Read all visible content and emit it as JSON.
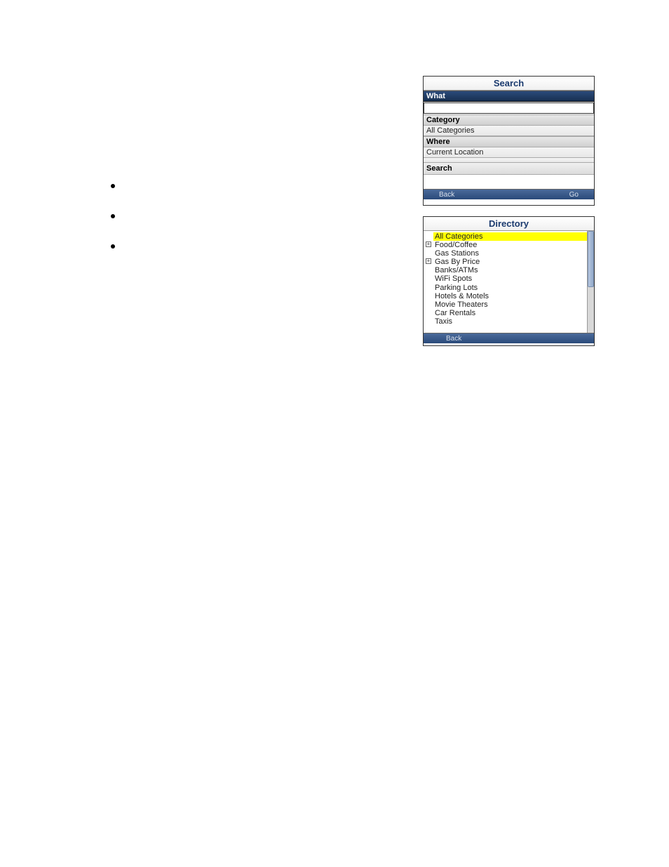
{
  "search_screen": {
    "title": "Search",
    "what_label": "What",
    "what_value": "",
    "category_label": "Category",
    "category_value": "All Categories",
    "where_label": "Where",
    "where_value": "Current Location",
    "search_button": "Search",
    "back_button": "Back",
    "go_button": "Go"
  },
  "directory_screen": {
    "title": "Directory",
    "items": [
      {
        "label": "All Categories",
        "selected": true,
        "expandable": false
      },
      {
        "label": "Food/Coffee",
        "selected": false,
        "expandable": true
      },
      {
        "label": "Gas Stations",
        "selected": false,
        "expandable": false
      },
      {
        "label": "Gas By Price",
        "selected": false,
        "expandable": true
      },
      {
        "label": "Banks/ATMs",
        "selected": false,
        "expandable": false
      },
      {
        "label": "WiFi Spots",
        "selected": false,
        "expandable": false
      },
      {
        "label": "Parking Lots",
        "selected": false,
        "expandable": false
      },
      {
        "label": "Hotels & Motels",
        "selected": false,
        "expandable": false
      },
      {
        "label": "Movie Theaters",
        "selected": false,
        "expandable": false
      },
      {
        "label": "Car Rentals",
        "selected": false,
        "expandable": false
      },
      {
        "label": "Taxis",
        "selected": false,
        "expandable": false
      }
    ],
    "back_button": "Back"
  }
}
